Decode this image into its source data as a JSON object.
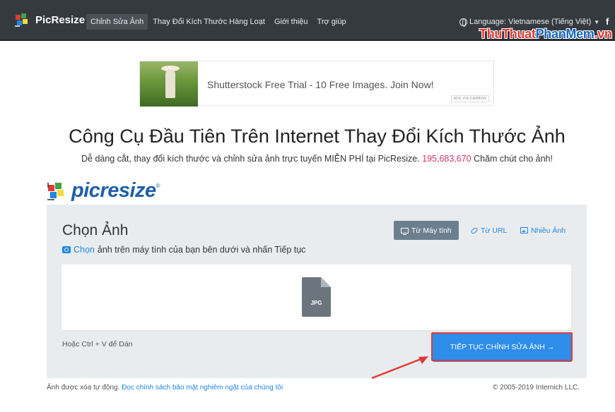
{
  "navbar": {
    "brand": "PicResize",
    "links": [
      {
        "label": "Chỉnh Sửa Ảnh",
        "active": true
      },
      {
        "label": "Thay Đổi Kích Thước Hàng Loạt",
        "active": false
      },
      {
        "label": "Giới thiệu",
        "active": false
      },
      {
        "label": "Trợ giúp",
        "active": false
      }
    ],
    "language": "Language: Vietnamese (Tiếng Việt)",
    "facebook": "f"
  },
  "watermark": {
    "part1": "ThuThuat",
    "part2": "PhanMem",
    "part3": ".vn"
  },
  "ad": {
    "text": "Shutterstock Free Trial - 10 Free Images. Join Now!",
    "via": "ADS VIA CARBON"
  },
  "hero": {
    "title": "Công Cụ Đầu Tiên Trên Internet Thay Đổi Kích Thước Ảnh",
    "subtitle_before": "Dễ dàng cắt, thay đổi kích thước và chỉnh sửa ảnh trực tuyến MIỄN PHÍ tại PicResize. ",
    "count": "195,683,670",
    "subtitle_after": " Chăm chút cho ảnh!"
  },
  "logo": {
    "pic": "pic",
    "resize": "resize",
    "reg": "®"
  },
  "panel": {
    "title": "Chọn Ảnh",
    "hint_link": "Chọn",
    "hint_text": "ảnh trên máy tính của bạn bên dưới và nhấn Tiếp tục",
    "sources": [
      {
        "label": "Từ Máy tính",
        "icon": "monitor-icon"
      },
      {
        "label": "Từ URL",
        "icon": "link-icon"
      },
      {
        "label": "Nhiều Ảnh",
        "icon": "images-icon"
      }
    ],
    "file_type": "JPG",
    "paste_hint": "Hoặc Ctrl + V để Dán",
    "continue_label": "TIẾP TỤC CHỈNH SỬA ẢNH →"
  },
  "footer": {
    "left_text": "Ảnh được xóa tự động. ",
    "left_link": "Đọc chính sách bảo mật nghiêm ngặt của chúng tôi",
    "copyright": "© 2005-2019 Internich LLC."
  },
  "colors": {
    "navbar": "#343a40",
    "accent": "#2f8dea",
    "annotation": "#e53935",
    "count": "#d6336c"
  }
}
